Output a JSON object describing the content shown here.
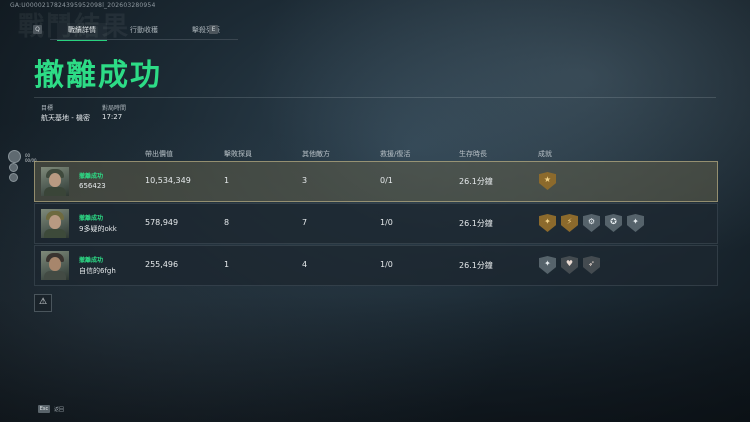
{
  "header": {
    "uid": "GA:U0000217824395952098l_202603280954",
    "ghost_title": "戰鬥結果"
  },
  "tabs": {
    "left_key": "Q",
    "right_key": "E",
    "items": [
      {
        "label": "戰績詳情",
        "active": true
      },
      {
        "label": "行動收穫",
        "active": false
      },
      {
        "label": "擊殺列表",
        "active": false
      }
    ]
  },
  "result": {
    "title": "撤離成功",
    "color": "#2ddc86"
  },
  "info": {
    "target_label": "目標",
    "target_value": "航天基地 - 機密",
    "duration_label": "對局時間",
    "duration_value": "17:27"
  },
  "side": {
    "label": "00 00/00"
  },
  "table": {
    "headers": [
      "帶出價值",
      "擊敗探員",
      "其他敵方",
      "救援/復活",
      "生存時長",
      "成就"
    ],
    "rows": [
      {
        "status": "撤離成功",
        "name": "656423",
        "value": "10,534,349",
        "kills": "1",
        "other": "3",
        "rescue": "0/1",
        "survival": "26.1分鐘",
        "highlight": true,
        "badges": [
          {
            "icon": "gold-medal-icon",
            "style": "gold",
            "glyph": "★"
          }
        ]
      },
      {
        "status": "撤離成功",
        "name": "9多疑的okk",
        "value": "578,949",
        "kills": "8",
        "other": "7",
        "rescue": "1/0",
        "survival": "26.1分鐘",
        "highlight": false,
        "badges": [
          {
            "icon": "gold-star-badge-icon",
            "style": "gold",
            "glyph": "✦"
          },
          {
            "icon": "gold-runner-badge-icon",
            "style": "gold",
            "glyph": "⚡"
          },
          {
            "icon": "silver-gear-badge-icon",
            "style": "silver",
            "glyph": "⚙"
          },
          {
            "icon": "silver-wreath-badge-icon",
            "style": "silver",
            "glyph": "✪"
          },
          {
            "icon": "silver-star-badge-icon",
            "style": "silver",
            "glyph": "✦"
          }
        ]
      },
      {
        "status": "撤離成功",
        "name": "自信的6fgh",
        "value": "255,496",
        "kills": "1",
        "other": "4",
        "rescue": "1/0",
        "survival": "26.1分鐘",
        "highlight": false,
        "badges": [
          {
            "icon": "silver-star-badge-icon",
            "style": "silver",
            "glyph": "✦"
          },
          {
            "icon": "heart-badge-icon",
            "style": "dark",
            "glyph": "♥"
          },
          {
            "icon": "wing-badge-icon",
            "style": "dark",
            "glyph": "➶"
          }
        ]
      }
    ]
  },
  "footer": {
    "warning_glyph": "⚠",
    "esc_key": "Esc",
    "esc_label": "返回"
  }
}
